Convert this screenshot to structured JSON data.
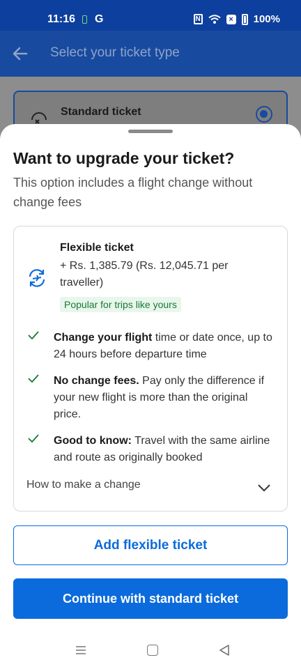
{
  "status_bar": {
    "time": "11:16",
    "carrier_glyph": "G",
    "battery_percent": "100%",
    "icons": [
      "battery-saver-icon",
      "nfc-icon",
      "wifi-icon",
      "x-notification-icon",
      "battery-icon"
    ]
  },
  "header": {
    "title": "Select your ticket type",
    "back_icon": "arrow-left-icon"
  },
  "background_card": {
    "label": "Standard ticket",
    "selected": true
  },
  "sheet": {
    "title": "Want to upgrade your ticket?",
    "subtitle": "This option includes a flight change without change fees",
    "card": {
      "name": "Flexible ticket",
      "price": "+ Rs. 1,385.79 (Rs. 12,045.71 per traveller)",
      "badge": "Popular for trips like yours",
      "features": [
        {
          "bold": "Change your flight",
          "rest": " time or date once, up to 24 hours before departure time"
        },
        {
          "bold": "No change fees.",
          "rest": " Pay only the difference if your new flight is more than the original price."
        },
        {
          "bold": "Good to know:",
          "rest": " Travel with the same airline and route as originally booked"
        }
      ],
      "howto_label": "How to make a change"
    },
    "add_button": "Add flexible ticket",
    "continue_button": "Continue with standard ticket"
  },
  "colors": {
    "brand_dark": "#184a9f",
    "primary_blue": "#0b6bdc",
    "success_green": "#167a36"
  }
}
